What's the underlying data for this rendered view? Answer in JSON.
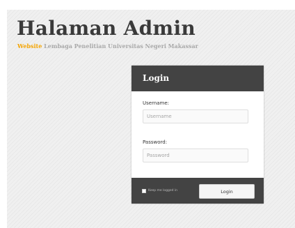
{
  "header": {
    "title": "Halaman Admin",
    "tagline_accent": "Website",
    "tagline_rest": "Lembaga Penelitian Universitas Negeri Makassar"
  },
  "login": {
    "title": "Login",
    "username_label": "Username:",
    "username_placeholder": "Username",
    "username_value": "",
    "password_label": "Password:",
    "password_placeholder": "Password",
    "password_value": "",
    "remember_label": "Keep me logged in",
    "remember_checked": false,
    "button_label": "Login"
  },
  "colors": {
    "accent": "#f4a400",
    "panel_dark": "#434343",
    "background": "#f0f0f0"
  }
}
